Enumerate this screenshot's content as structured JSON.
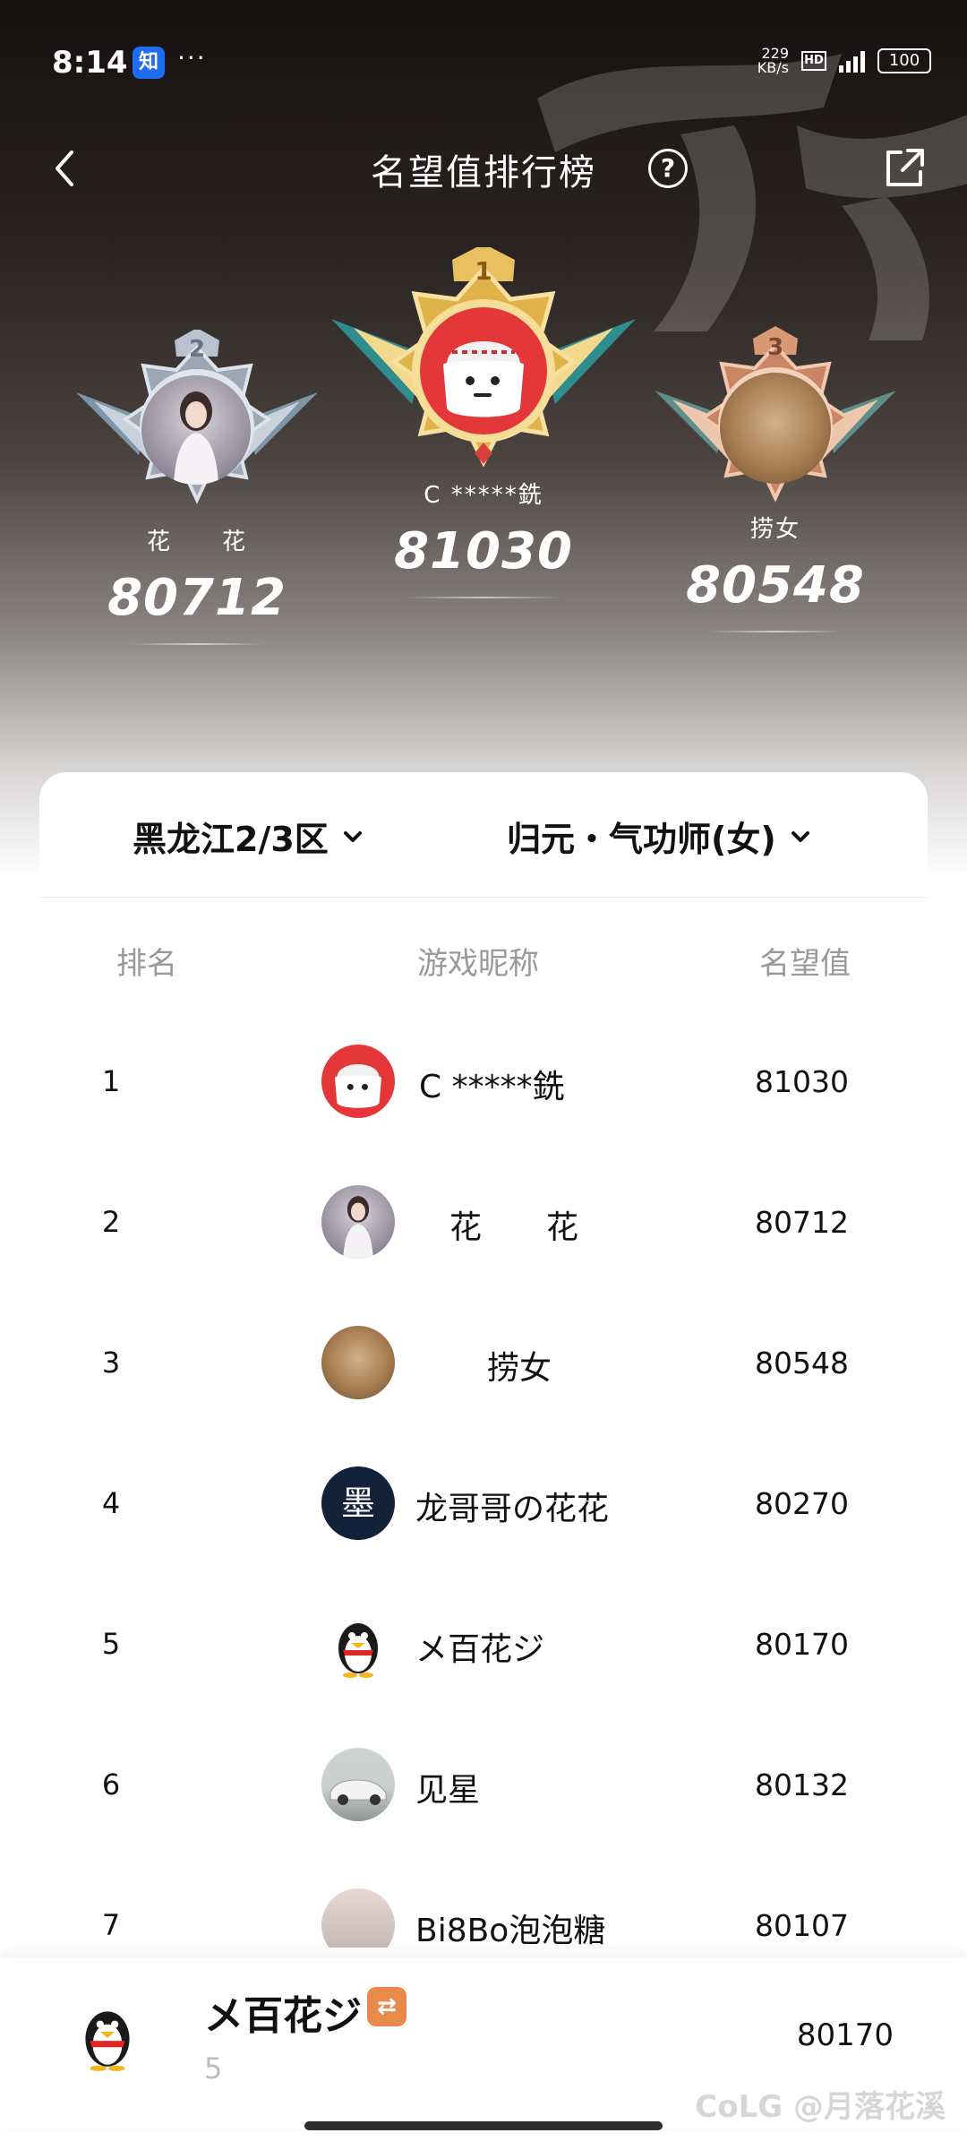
{
  "status_bar": {
    "time": "8:14",
    "app_badge": "知",
    "dots": "···",
    "net_speed_value": "229",
    "net_speed_unit": "KB/s",
    "hd_label": "HD",
    "battery": "100"
  },
  "nav": {
    "title": "名望值排行榜",
    "help_label": "?"
  },
  "podium": [
    {
      "rank": "2",
      "name": "花　　花",
      "score": "80712"
    },
    {
      "rank": "1",
      "name": "C *****銑",
      "score": "81030"
    },
    {
      "rank": "3",
      "name": "捞女",
      "score": "80548"
    }
  ],
  "filters": {
    "region": "黑龙江2/3区",
    "class": "归元・气功师(女)"
  },
  "table": {
    "headers": {
      "rank": "排名",
      "nickname": "游戏昵称",
      "value": "名望值"
    },
    "rows": [
      {
        "rank": "1",
        "nickname": "C *****銑",
        "value": "81030",
        "avatar": "red-mascot-avatar"
      },
      {
        "rank": "2",
        "nickname": "花　　花",
        "value": "80712",
        "avatar": "girl-photo-avatar"
      },
      {
        "rank": "3",
        "nickname": "捞女",
        "value": "80548",
        "avatar": "dog-photo-avatar"
      },
      {
        "rank": "4",
        "nickname": "龙哥哥の花花",
        "value": "80270",
        "avatar": "ink-calligraphy-avatar",
        "avatar_text": "墨"
      },
      {
        "rank": "5",
        "nickname": "メ百花ジ",
        "value": "80170",
        "avatar": "qq-penguin-avatar"
      },
      {
        "rank": "6",
        "nickname": "见星",
        "value": "80132",
        "avatar": "car-photo-avatar"
      },
      {
        "rank": "7",
        "nickname": "Bi8Bo泡泡糖",
        "value": "80107",
        "avatar": "blurred-photo-avatar"
      }
    ]
  },
  "me": {
    "name": "メ百花ジ",
    "badge": "⇄",
    "rank": "5",
    "score": "80170"
  },
  "watermark": "CoLG @月落花溪",
  "colors": {
    "gold": "#e0b24a",
    "silver": "#b9c3cf",
    "bronze": "#d79a74",
    "badge_orange": "#e88a4a",
    "avatar_red": "#e4373a"
  }
}
